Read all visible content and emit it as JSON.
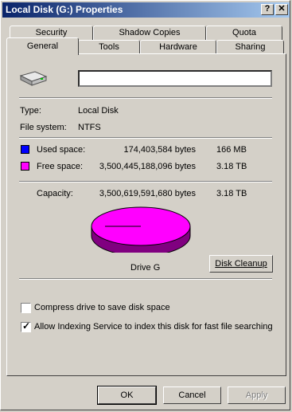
{
  "window": {
    "title": "Local Disk (G:) Properties",
    "help_button": "?",
    "close_button": "✕"
  },
  "tabs_row1": [
    "Security",
    "Shadow Copies",
    "Quota"
  ],
  "tabs_row2": [
    "General",
    "Tools",
    "Hardware",
    "Sharing"
  ],
  "drive": {
    "icon": "drive-icon",
    "label_value": ""
  },
  "type": {
    "label": "Type:",
    "value": "Local Disk"
  },
  "filesystem": {
    "label": "File system:",
    "value": "NTFS"
  },
  "used": {
    "label": "Used space:",
    "bytes": "174,403,584 bytes",
    "size": "166 MB",
    "color": "#0000ff"
  },
  "free": {
    "label": "Free space:",
    "bytes": "3,500,445,188,096 bytes",
    "size": "3.18 TB",
    "color": "#ff00ff"
  },
  "capacity": {
    "label": "Capacity:",
    "bytes": "3,500,619,591,680 bytes",
    "size": "3.18 TB"
  },
  "pie": {
    "used_fraction": 4.98e-05,
    "free_color": "#ff00ff",
    "dark_free_color": "#800080"
  },
  "drive_caption": "Drive G",
  "disk_cleanup": "Disk Cleanup",
  "compress": {
    "label": "Compress drive to save disk space",
    "checked": false
  },
  "indexing": {
    "label": "Allow Indexing Service to index this disk for fast file searching",
    "checked": true
  },
  "buttons": {
    "ok": "OK",
    "cancel": "Cancel",
    "apply": "Apply"
  }
}
